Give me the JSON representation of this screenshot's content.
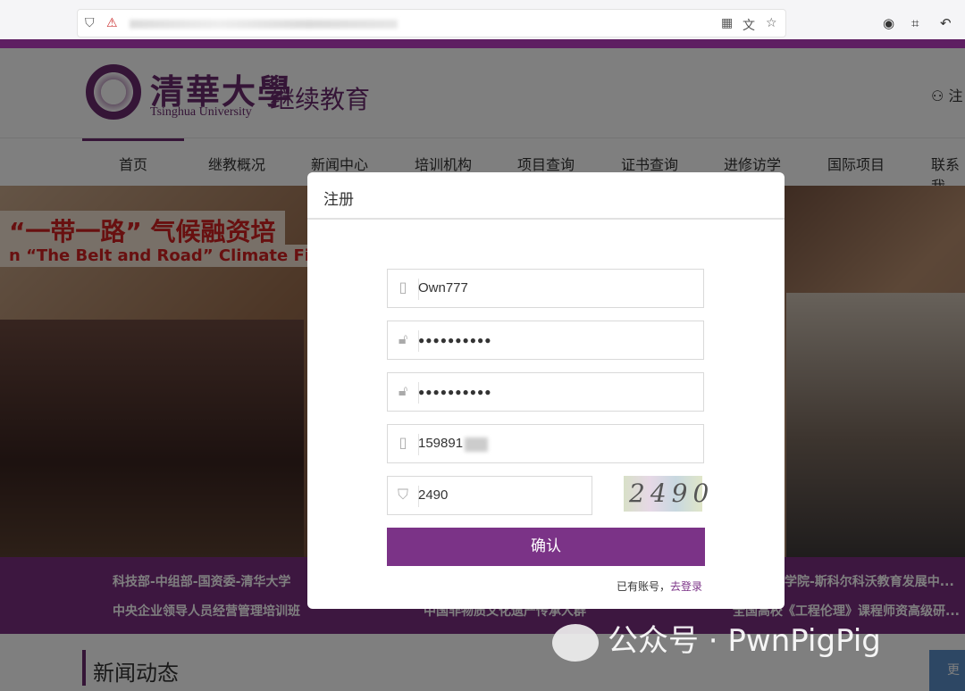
{
  "site": {
    "logo_cn": "清華大學",
    "logo_en": "Tsinghua University",
    "logo_sub": "继续教育",
    "user_label": "注",
    "nav": [
      {
        "label": "首页"
      },
      {
        "label": "继教概况"
      },
      {
        "label": "新闻中心"
      },
      {
        "label": "培训机构"
      },
      {
        "label": "项目查询"
      },
      {
        "label": "证书查询"
      },
      {
        "label": "进修访学"
      },
      {
        "label": "国际项目"
      },
      {
        "label": "联系我"
      }
    ],
    "banner_cn": "“一带一路” 气候融资培",
    "banner_en": "n “The Belt and Road” Climate Finan",
    "strip_items": [
      "科技部-中组部-国资委-清华大学",
      "中央企业领导人员经营管理培训班",
      "学院-斯科尔科沃教育发展中...",
      "全国高校《工程伦理》课程师资高级研...",
      "中国非物质文化遗产传承人群"
    ],
    "news_title": "新闻动态",
    "more_label": "更"
  },
  "modal": {
    "title": "注册",
    "username": "Own777",
    "password": "●●●●●●●●●●",
    "password_confirm": "●●●●●●●●●●",
    "phone": "159891",
    "captcha_input": "2490",
    "captcha_image_text": "2490",
    "confirm_label": "确认",
    "have_account": "已有账号，",
    "login_link": "去登录"
  },
  "watermark": "公众号 · PwnPigPig",
  "colors": {
    "accent": "#7b3387",
    "brand": "#6b2b6e"
  }
}
